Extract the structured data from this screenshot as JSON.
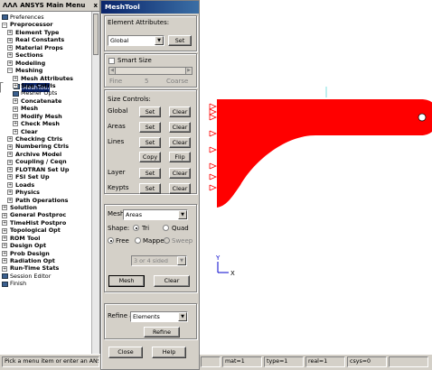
{
  "main_menu": {
    "title": "ANSYS Main Menu",
    "title_icons": "ΛΛΛ",
    "close_glyph": "x",
    "items": [
      {
        "label": "Preferences",
        "depth": 0,
        "kind": "leaf"
      },
      {
        "label": "Preprocessor",
        "depth": 0,
        "kind": "open"
      },
      {
        "label": "Element Type",
        "depth": 1,
        "kind": "closed"
      },
      {
        "label": "Real Constants",
        "depth": 1,
        "kind": "closed"
      },
      {
        "label": "Material Props",
        "depth": 1,
        "kind": "closed"
      },
      {
        "label": "Sections",
        "depth": 1,
        "kind": "closed"
      },
      {
        "label": "Modeling",
        "depth": 1,
        "kind": "closed"
      },
      {
        "label": "Meshing",
        "depth": 1,
        "kind": "open"
      },
      {
        "label": "Mesh Attributes",
        "depth": 2,
        "kind": "closed"
      },
      {
        "label": "MeshTool",
        "depth": 2,
        "kind": "leaf",
        "selected": true
      },
      {
        "label": "Size Cntrls",
        "depth": 2,
        "kind": "closed"
      },
      {
        "label": "Mesher Opts",
        "depth": 2,
        "kind": "leaf"
      },
      {
        "label": "Concatenate",
        "depth": 2,
        "kind": "closed"
      },
      {
        "label": "Mesh",
        "depth": 2,
        "kind": "closed"
      },
      {
        "label": "Modify Mesh",
        "depth": 2,
        "kind": "closed"
      },
      {
        "label": "Check Mesh",
        "depth": 2,
        "kind": "closed"
      },
      {
        "label": "Clear",
        "depth": 2,
        "kind": "closed"
      },
      {
        "label": "Checking Ctrls",
        "depth": 1,
        "kind": "closed"
      },
      {
        "label": "Numbering Ctrls",
        "depth": 1,
        "kind": "closed"
      },
      {
        "label": "Archive Model",
        "depth": 1,
        "kind": "closed"
      },
      {
        "label": "Coupling / Ceqn",
        "depth": 1,
        "kind": "closed"
      },
      {
        "label": "FLOTRAN Set Up",
        "depth": 1,
        "kind": "closed"
      },
      {
        "label": "FSI Set Up",
        "depth": 1,
        "kind": "closed"
      },
      {
        "label": "Loads",
        "depth": 1,
        "kind": "closed"
      },
      {
        "label": "Physics",
        "depth": 1,
        "kind": "closed"
      },
      {
        "label": "Path Operations",
        "depth": 1,
        "kind": "closed"
      },
      {
        "label": "Solution",
        "depth": 0,
        "kind": "closed"
      },
      {
        "label": "General Postproc",
        "depth": 0,
        "kind": "closed"
      },
      {
        "label": "TimeHist Postpro",
        "depth": 0,
        "kind": "closed"
      },
      {
        "label": "Topological Opt",
        "depth": 0,
        "kind": "closed"
      },
      {
        "label": "ROM Tool",
        "depth": 0,
        "kind": "closed"
      },
      {
        "label": "Design Opt",
        "depth": 0,
        "kind": "closed"
      },
      {
        "label": "Prob Design",
        "depth": 0,
        "kind": "closed"
      },
      {
        "label": "Radiation Opt",
        "depth": 0,
        "kind": "closed"
      },
      {
        "label": "Run-Time Stats",
        "depth": 0,
        "kind": "closed"
      },
      {
        "label": "Session Editor",
        "depth": 0,
        "kind": "leaf"
      },
      {
        "label": "Finish",
        "depth": 0,
        "kind": "leaf"
      }
    ]
  },
  "meshtool": {
    "title": "MeshTool",
    "element_attributes": {
      "label": "Element Attributes:",
      "select_value": "Global",
      "set_button": "Set"
    },
    "smart_size": {
      "label": "Smart Size",
      "checked": false,
      "fine_label": "Fine",
      "value": "5",
      "coarse_label": "Coarse",
      "level": 5
    },
    "size_controls": {
      "label": "Size Controls:",
      "rows": [
        {
          "label": "Global",
          "set": "Set",
          "clear": "Clear"
        },
        {
          "label": "Areas",
          "set": "Set",
          "clear": "Clear"
        },
        {
          "label": "Lines",
          "set": "Set",
          "clear": "Clear"
        },
        {
          "label": "",
          "set": "Copy",
          "clear": "Flip"
        },
        {
          "label": "Layer",
          "set": "Set",
          "clear": "Clear"
        },
        {
          "label": "Keypts",
          "set": "Set",
          "clear": "Clear"
        }
      ]
    },
    "mesh": {
      "label": "Mesh:",
      "select_value": "Areas",
      "shape_label": "Shape:",
      "shape_tri": "Tri",
      "shape_quad": "Quad",
      "shape_selected": "Tri",
      "free_label": "Free",
      "mapped_label": "Mapped",
      "sweep_label": "Sweep",
      "mode_selected": "Free",
      "sided_value": "3 or 4 sided",
      "mesh_button": "Mesh",
      "clear_button": "Clear"
    },
    "refine": {
      "label": "Refine at:",
      "select_value": "Elements",
      "button": "Refine"
    },
    "close_button": "Close",
    "help_button": "Help"
  },
  "graphics": {
    "model_color": "#ff0000",
    "triad_x": "X",
    "triad_y": "Y"
  },
  "status_bar": {
    "prompt": "Pick a menu item or enter an ANSYS Command",
    "mat": "mat=1",
    "type": "type=1",
    "real": "real=1",
    "csys": "csys=0"
  }
}
